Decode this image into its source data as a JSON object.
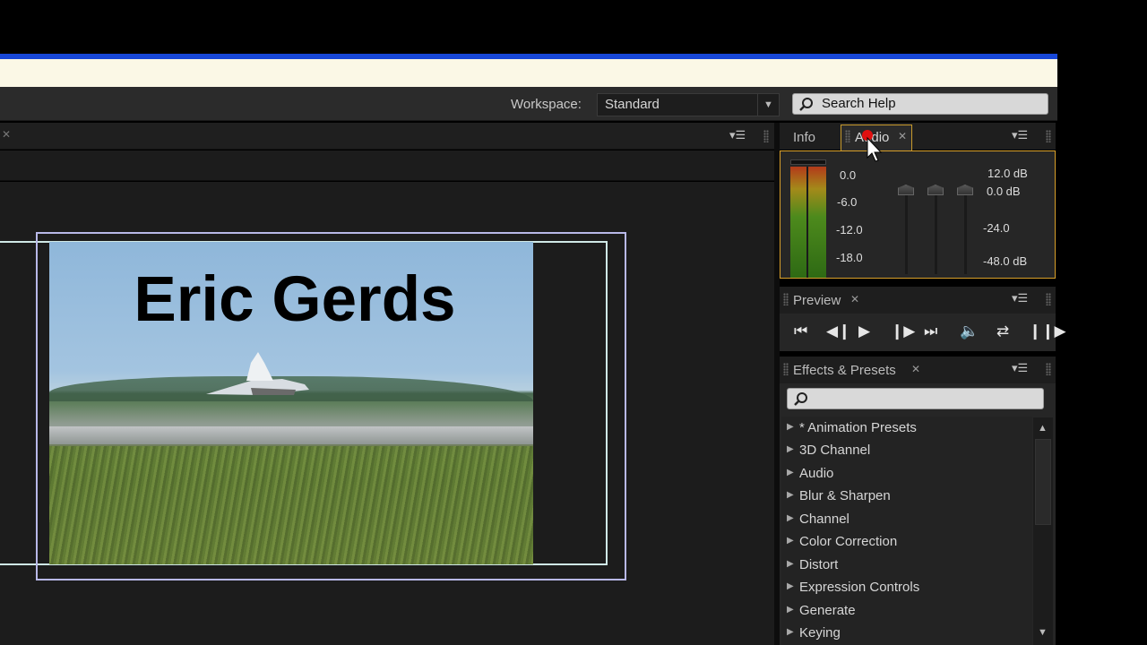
{
  "toolbar": {
    "workspace_label": "Workspace:",
    "workspace_value": "Standard",
    "search_help": "Search Help"
  },
  "video": {
    "title_text": "Eric Gerds"
  },
  "info_panel": {
    "tabs": [
      {
        "label": "Info",
        "active": false
      },
      {
        "label": "Audio",
        "active": true
      }
    ],
    "audio": {
      "left_scale": [
        "0.0",
        "-6.0",
        "-12.0",
        "-18.0"
      ],
      "right_scale": [
        "12.0 dB",
        "0.0 dB",
        "-24.0",
        "-48.0 dB"
      ]
    }
  },
  "preview_panel": {
    "tab_label": "Preview",
    "controls": [
      "first-frame",
      "previous-frame",
      "play",
      "next-frame",
      "last-frame",
      "audio",
      "loop",
      "ram-preview"
    ]
  },
  "effects_panel": {
    "tab_label": "Effects & Presets",
    "search_value": "",
    "items": [
      "* Animation Presets",
      "3D Channel",
      "Audio",
      "Blur & Sharpen",
      "Channel",
      "Color Correction",
      "Distort",
      "Expression Controls",
      "Generate",
      "Keying"
    ]
  },
  "colors": {
    "active_tab_border": "#c79a2c",
    "title_bar_accent": "#1747d8",
    "panel_bg": "#262626"
  }
}
